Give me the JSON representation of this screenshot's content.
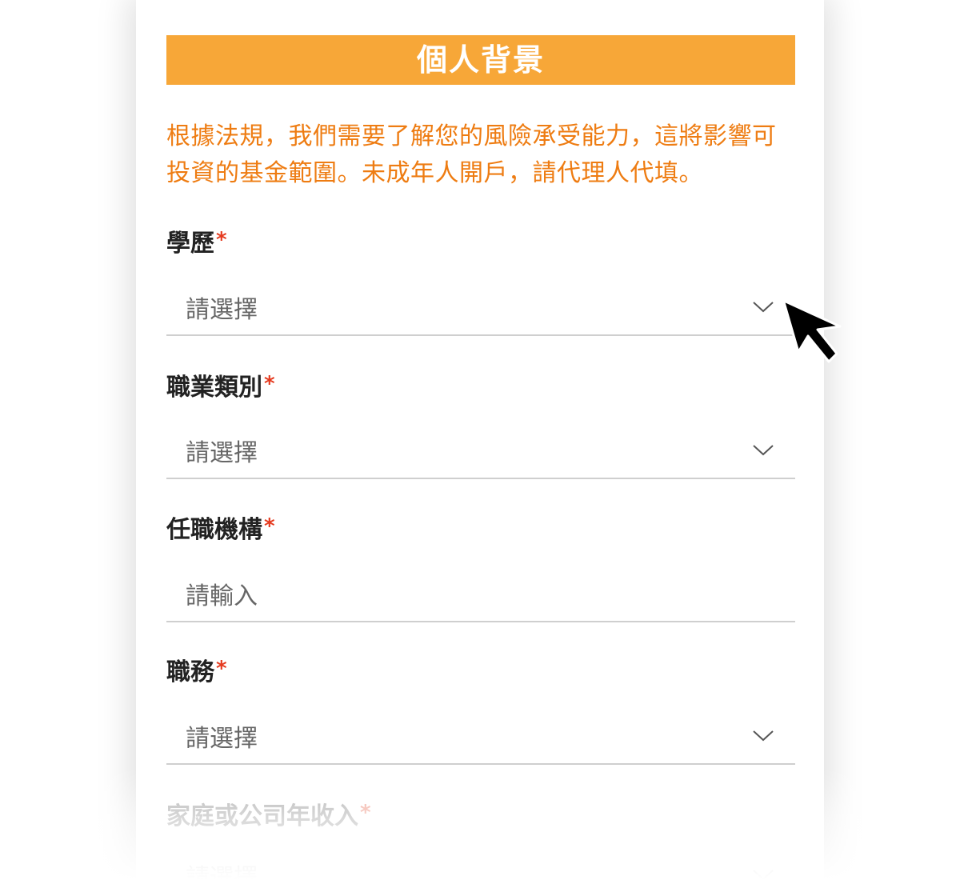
{
  "section": {
    "title": "個人背景",
    "notice": "根據法規，我們需要了解您的風險承受能力，這將影響可投資的基金範圍。未成年人開戶，請代理人代填。"
  },
  "fields": [
    {
      "label": "學歷",
      "required_mark": "*",
      "placeholder": "請選擇",
      "type": "select"
    },
    {
      "label": "職業類別",
      "required_mark": "*",
      "placeholder": "請選擇",
      "type": "select"
    },
    {
      "label": "任職機構",
      "required_mark": "*",
      "placeholder": "請輸入",
      "type": "text"
    },
    {
      "label": "職務",
      "required_mark": "*",
      "placeholder": "請選擇",
      "type": "select"
    },
    {
      "label": "家庭或公司年收入",
      "required_mark": "*",
      "placeholder": "請選擇",
      "type": "select"
    }
  ],
  "colors": {
    "header_bg": "#F7A738",
    "notice_text": "#EE7C12",
    "required": "#E53B20",
    "divider": "#cfcfcf"
  },
  "icons": {
    "dropdown": "chevron-down-icon",
    "pointer": "mouse-cursor-icon"
  }
}
